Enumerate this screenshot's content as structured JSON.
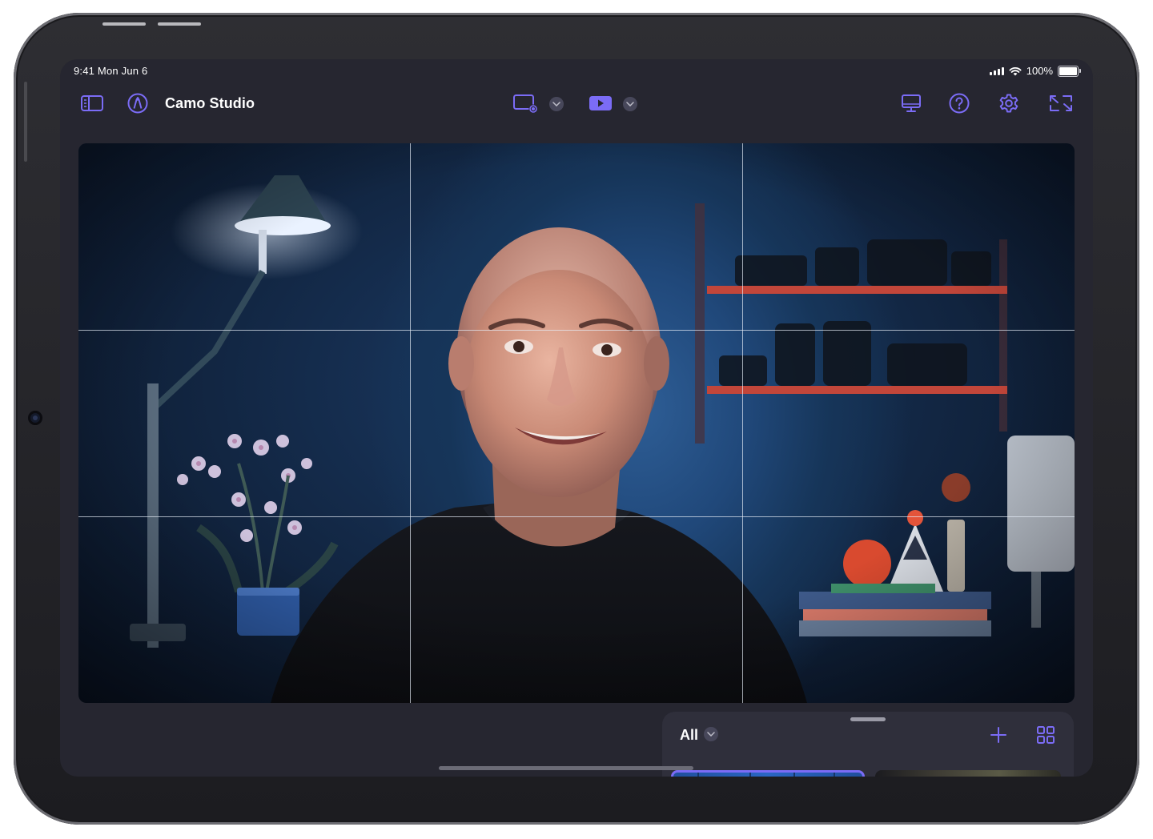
{
  "status_bar": {
    "time": "9:41",
    "date": "Mon Jun 6",
    "battery": "100%",
    "battery_level": 1.0
  },
  "toolbar": {
    "app_title": "Camo Studio",
    "left_icons": [
      "sidebar-icon",
      "pencil-tip-icon"
    ],
    "center_icons": [
      "screen-record-icon",
      "chevron-down-icon",
      "video-play-icon",
      "chevron-down-icon"
    ],
    "right_icons": [
      "display-icon",
      "help-icon",
      "gear-icon",
      "fullscreen-icon"
    ]
  },
  "preview": {
    "grid_overlay": "rule-of-thirds",
    "grid_on": true
  },
  "scenes_panel": {
    "filter_label": "All",
    "icons": [
      "plus-icon",
      "grid-view-icon"
    ]
  },
  "colors": {
    "accent": "#7b6cf6",
    "background": "#262630",
    "panel": "#2f2f3b"
  }
}
